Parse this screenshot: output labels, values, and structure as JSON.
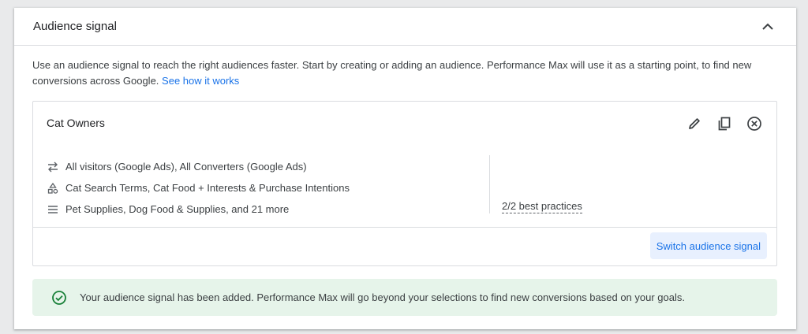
{
  "card": {
    "title": "Audience signal",
    "collapse_icon": "chevron-up-icon"
  },
  "description": {
    "text": "Use an audience signal to reach the right audiences faster. Start by creating or adding an audience. Performance Max will use it as a starting point, to find new conversions across Google.",
    "link": "See how it works"
  },
  "audience": {
    "name": "Cat Owners",
    "actions": [
      "edit-icon",
      "copy-icon",
      "remove-icon"
    ],
    "rows": [
      {
        "icon": "swap-arrows-icon",
        "text": "All visitors (Google Ads), All Converters (Google Ads)"
      },
      {
        "icon": "shapes-icon",
        "text": "Cat Search Terms, Cat Food + Interests & Purchase Intentions"
      },
      {
        "icon": "list-icon",
        "text": "Pet Supplies, Dog Food & Supplies, and 21 more"
      }
    ],
    "best_practices": "2/2 best practices",
    "switch_button": "Switch audience signal"
  },
  "banner": {
    "icon": "check-circle-icon",
    "text": "Your audience signal has been added. Performance Max will go beyond your selections to find new conversions based on your goals.",
    "color": "#e6f4ea"
  },
  "colors": {
    "link": "#1a73e8",
    "button_bg": "#e8f0fe",
    "success": "#188038"
  }
}
